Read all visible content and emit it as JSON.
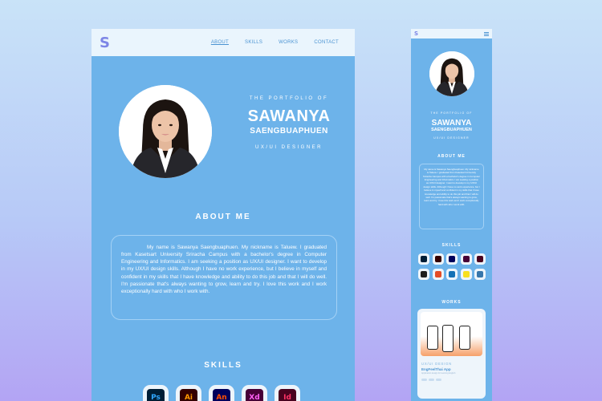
{
  "desktop": {
    "nav": {
      "logo": "S",
      "links": [
        {
          "label": "ABOUT",
          "active": true
        },
        {
          "label": "SKILLS",
          "active": false
        },
        {
          "label": "WORKS",
          "active": false
        },
        {
          "label": "CONTACT",
          "active": false
        }
      ]
    },
    "hero": {
      "kicker": "THE PORTFOLIO OF",
      "first_name": "SAWANYA",
      "last_name": "SAENGBUAPHUEN",
      "role": "UX/UI DESIGNER"
    },
    "about": {
      "title": "ABOUT ME",
      "text": "My name is Sawanya Saengbuaphuen. My nickname is Taluew. I graduated from Kasetsart University Sriracha Campus with a bachelor's degree in Computer Engineering and Informatics. I am seeking a position as UX/UI designer. I want to develop in my UX/UI design skills. Although I have no work experience, but I believe in myself and confident in my skills that I have knowledge and ability to do this job and that I will do well. I'm passionate that's always wanting to grow, learn and try. I love this work and I work exceptionally hard with who I work with."
    },
    "skills": {
      "title": "SKILLS",
      "items": [
        {
          "label": "Ps",
          "icon": "photoshop-icon",
          "bg": "#001e36",
          "fg": "#31a8ff"
        },
        {
          "label": "Ai",
          "icon": "illustrator-icon",
          "bg": "#330000",
          "fg": "#ff9a00"
        },
        {
          "label": "An",
          "icon": "animate-icon",
          "bg": "#00005b",
          "fg": "#ff4f00"
        },
        {
          "label": "Xd",
          "icon": "xd-icon",
          "bg": "#470137",
          "fg": "#ff61f6"
        },
        {
          "label": "Id",
          "icon": "indesign-icon",
          "bg": "#49021f",
          "fg": "#ff3366"
        }
      ]
    }
  },
  "mobile": {
    "nav": {
      "logo": "S"
    },
    "hero": {
      "kicker": "THE PORTFOLIO OF",
      "first_name": "SAWANYA",
      "last_name": "SAENGBUAPHUEN",
      "role": "UX/UI DESIGNER"
    },
    "about": {
      "title": "ABOUT ME",
      "text": "My name is Sawanya Saengbuaphuen. My nickname is Taluew. I graduated from Kasetsart University Sriracha Campus with a bachelor's degree in Computer Engineering and Informatics. I am seeking a position as UX/UI designer. I want to develop in my UX/UI design skills. Although I have no work experience, but I believe in myself and confident in my skills that I have knowledge and ability to do this job and that I will do well. I'm passionate that's always wanting to grow, learn and try. I love this work and I work exceptionally hard with who I work with."
    },
    "skills": {
      "title": "SKILLS",
      "colors": [
        "#001e36",
        "#330000",
        "#00005b",
        "#470137",
        "#49021f",
        "#1e1e1e",
        "#e44d26",
        "#1572b6",
        "#f7df1e",
        "#3776ab"
      ]
    },
    "works": {
      "title": "WORKS",
      "card": {
        "category": "UX/UI DESIGN",
        "name": "EngFeelThai App",
        "desc": "Application design for learning English"
      }
    }
  },
  "colors": {
    "panel_blue": "#6db3ea",
    "nav_bg": "#eaf5fd",
    "accent": "#7d86e6"
  }
}
